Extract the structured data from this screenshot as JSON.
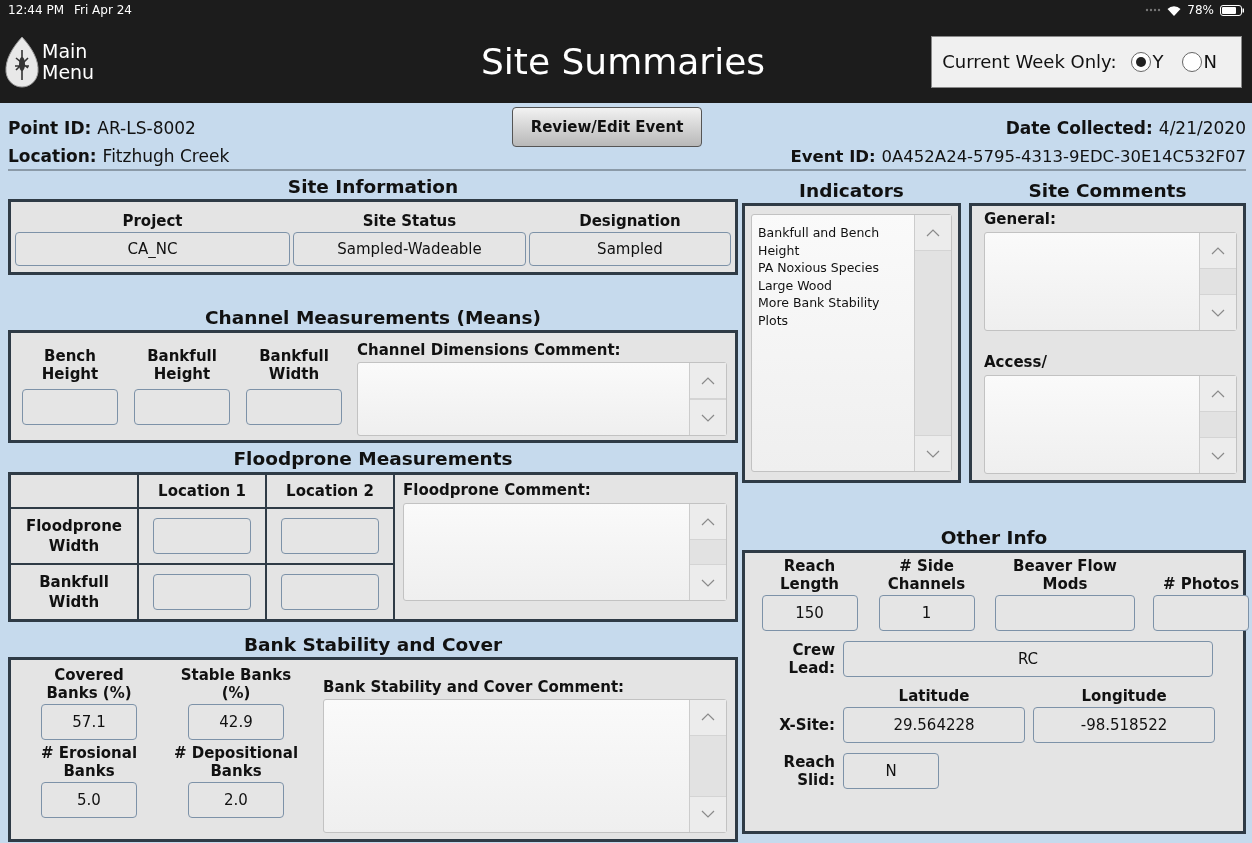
{
  "status_bar": {
    "time": "12:44 PM",
    "date": "Fri Apr 24",
    "battery": "78%"
  },
  "header": {
    "menu_button": "Main Menu",
    "title": "Site Summaries",
    "filter": {
      "label": "Current Week Only:",
      "options": [
        {
          "label": "Y",
          "selected": true
        },
        {
          "label": "N",
          "selected": false
        }
      ]
    }
  },
  "summary": {
    "point_id": {
      "label": "Point ID:",
      "value": "AR-LS-8002"
    },
    "location": {
      "label": "Location:",
      "value": "Fitzhugh Creek"
    },
    "review_button": "Review/Edit Event",
    "date_collected": {
      "label": "Date Collected:",
      "value": "4/21/2020"
    },
    "event_id": {
      "label": "Event ID:",
      "value": "0A452A24-5795-4313-9EDC-30E14C532F07"
    }
  },
  "site_information": {
    "title": "Site Information",
    "fields": [
      {
        "label": "Project",
        "value": "CA_NC"
      },
      {
        "label": "Site Status",
        "value": "Sampled-Wadeable"
      },
      {
        "label": "Designation",
        "value": "Sampled"
      }
    ]
  },
  "channel_measurements": {
    "title": "Channel Measurements (Means)",
    "fields": [
      {
        "label": "Bench Height"
      },
      {
        "label": "Bankfull Height"
      },
      {
        "label": "Bankfull Width"
      }
    ],
    "comment_label": "Channel Dimensions Comment:"
  },
  "floodprone_measurements": {
    "title": "Floodprone Measurements",
    "columns": [
      "Location 1",
      "Location 2"
    ],
    "rows": [
      {
        "label": "Floodprone Width"
      },
      {
        "label": "Bankfull Width"
      }
    ],
    "comment_label": "Floodprone Comment:"
  },
  "bank_stability": {
    "title": "Bank Stability and Cover",
    "fields": [
      {
        "label": "Covered Banks (%)",
        "value": "57.1"
      },
      {
        "label": "Stable Banks (%)",
        "value": "42.9"
      },
      {
        "label": "# Erosional Banks",
        "value": "5.0"
      },
      {
        "label": "# Depositional Banks",
        "value": "2.0"
      }
    ],
    "comment_label": "Bank Stability and Cover Comment:"
  },
  "indicators": {
    "title": "Indicators",
    "items": [
      "Bankfull and Bench Height",
      "PA Noxious Species",
      "Large Wood",
      "More Bank Stability Plots"
    ]
  },
  "site_comments": {
    "title": "Site Comments",
    "fields": [
      {
        "label": "General:"
      },
      {
        "label": "Access/"
      }
    ]
  },
  "other_info": {
    "title": "Other Info",
    "fields": [
      {
        "label": "Reach Length",
        "value": "150"
      },
      {
        "label": "# Side Channels",
        "value": "1"
      },
      {
        "label": "Beaver Flow Mods"
      },
      {
        "label": "# Photos"
      }
    ],
    "crew_lead": {
      "label": "Crew Lead:",
      "value": "RC"
    },
    "x_site": {
      "label": "X-Site:",
      "latitude_label": "Latitude",
      "longitude_label": "Longitude",
      "latitude": "29.564228",
      "longitude": "-98.518522"
    },
    "reach_slid": {
      "label": "Reach Slid:",
      "value": "N"
    }
  }
}
